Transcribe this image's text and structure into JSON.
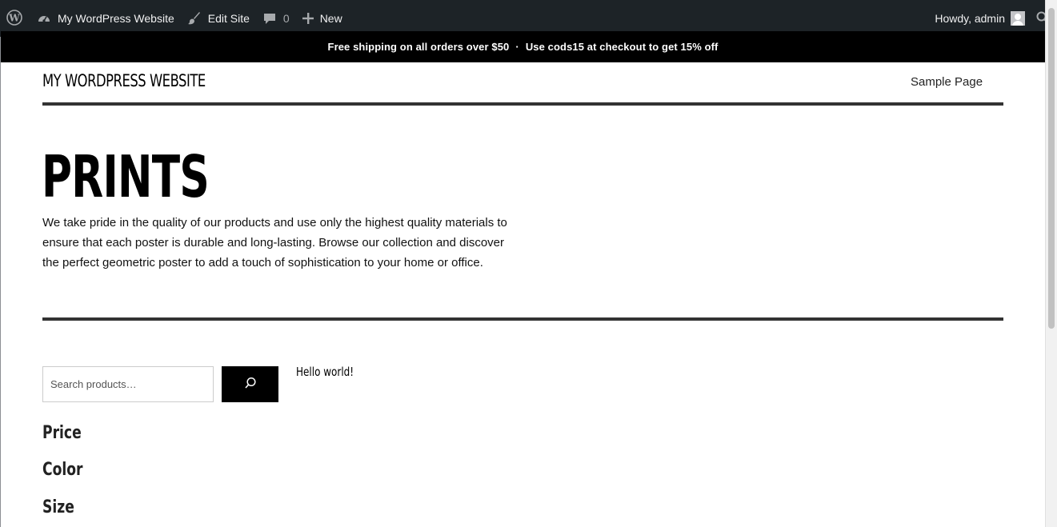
{
  "adminbar": {
    "wp_logo_icon": "wordpress-icon",
    "site_name": "My WordPress Website",
    "edit_site": "Edit Site",
    "comments_count": "0",
    "new_label": "New",
    "howdy": "Howdy, admin"
  },
  "promo": {
    "part1": "Free shipping on all orders over $50",
    "separator": "·",
    "part2": "Use cods15 at checkout to get 15% off"
  },
  "header": {
    "site_title": "MY WORDPRESS WEBSITE",
    "nav_sample_page": "Sample Page"
  },
  "hero": {
    "title": "PRINTS",
    "description": "We take pride in the quality of our products and use only the highest quality materials to ensure that each poster is durable and long-lasting. Browse our collection and discover the perfect geometric poster to add a touch of sophistication to your home or office."
  },
  "search": {
    "placeholder": "Search products…"
  },
  "posts": {
    "hello_world": "Hello world!"
  },
  "filters": {
    "price": "Price",
    "color": "Color",
    "size": "Size"
  },
  "colors": {
    "adminbar_bg": "#1d2327",
    "promo_bg": "#000000",
    "rule": "#333333"
  }
}
